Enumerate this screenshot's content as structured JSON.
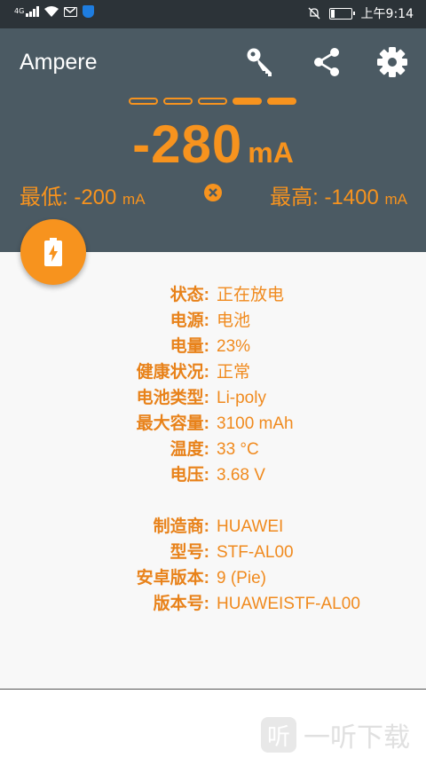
{
  "status_bar": {
    "network": "4G",
    "time": "上午9:14",
    "battery_level": 0.23
  },
  "header": {
    "app_title": "Ampere",
    "icons": [
      "key-icon",
      "share-icon",
      "gear-icon"
    ]
  },
  "meter": {
    "segments_total": 5,
    "segments_filled": 2,
    "current_value": "-280",
    "current_unit": "mA",
    "min_label": "最低: -200",
    "min_unit": "mA",
    "max_label": "最高: -1400",
    "max_unit": "mA"
  },
  "battery_info": [
    {
      "label": "状态:",
      "value": "正在放电"
    },
    {
      "label": "电源:",
      "value": "电池"
    },
    {
      "label": "电量:",
      "value": "23%"
    },
    {
      "label": "健康状况:",
      "value": "正常"
    },
    {
      "label": "电池类型:",
      "value": "Li-poly"
    },
    {
      "label": "最大容量:",
      "value": "3100 mAh"
    },
    {
      "label": "温度:",
      "value": "33 °C"
    },
    {
      "label": "电压:",
      "value": "3.68 V"
    }
  ],
  "device_info": [
    {
      "label": "制造商:",
      "value": "HUAWEI"
    },
    {
      "label": "型号:",
      "value": "STF-AL00"
    },
    {
      "label": "安卓版本:",
      "value": "9 (Pie)"
    },
    {
      "label": "版本号:",
      "value": "HUAWEISTF-AL00"
    }
  ],
  "watermark": {
    "logo_char": "听",
    "text": "一听下载"
  },
  "colors": {
    "accent": "#f7931e",
    "header_bg": "#4b5a63",
    "status_bg": "#2c3338"
  }
}
